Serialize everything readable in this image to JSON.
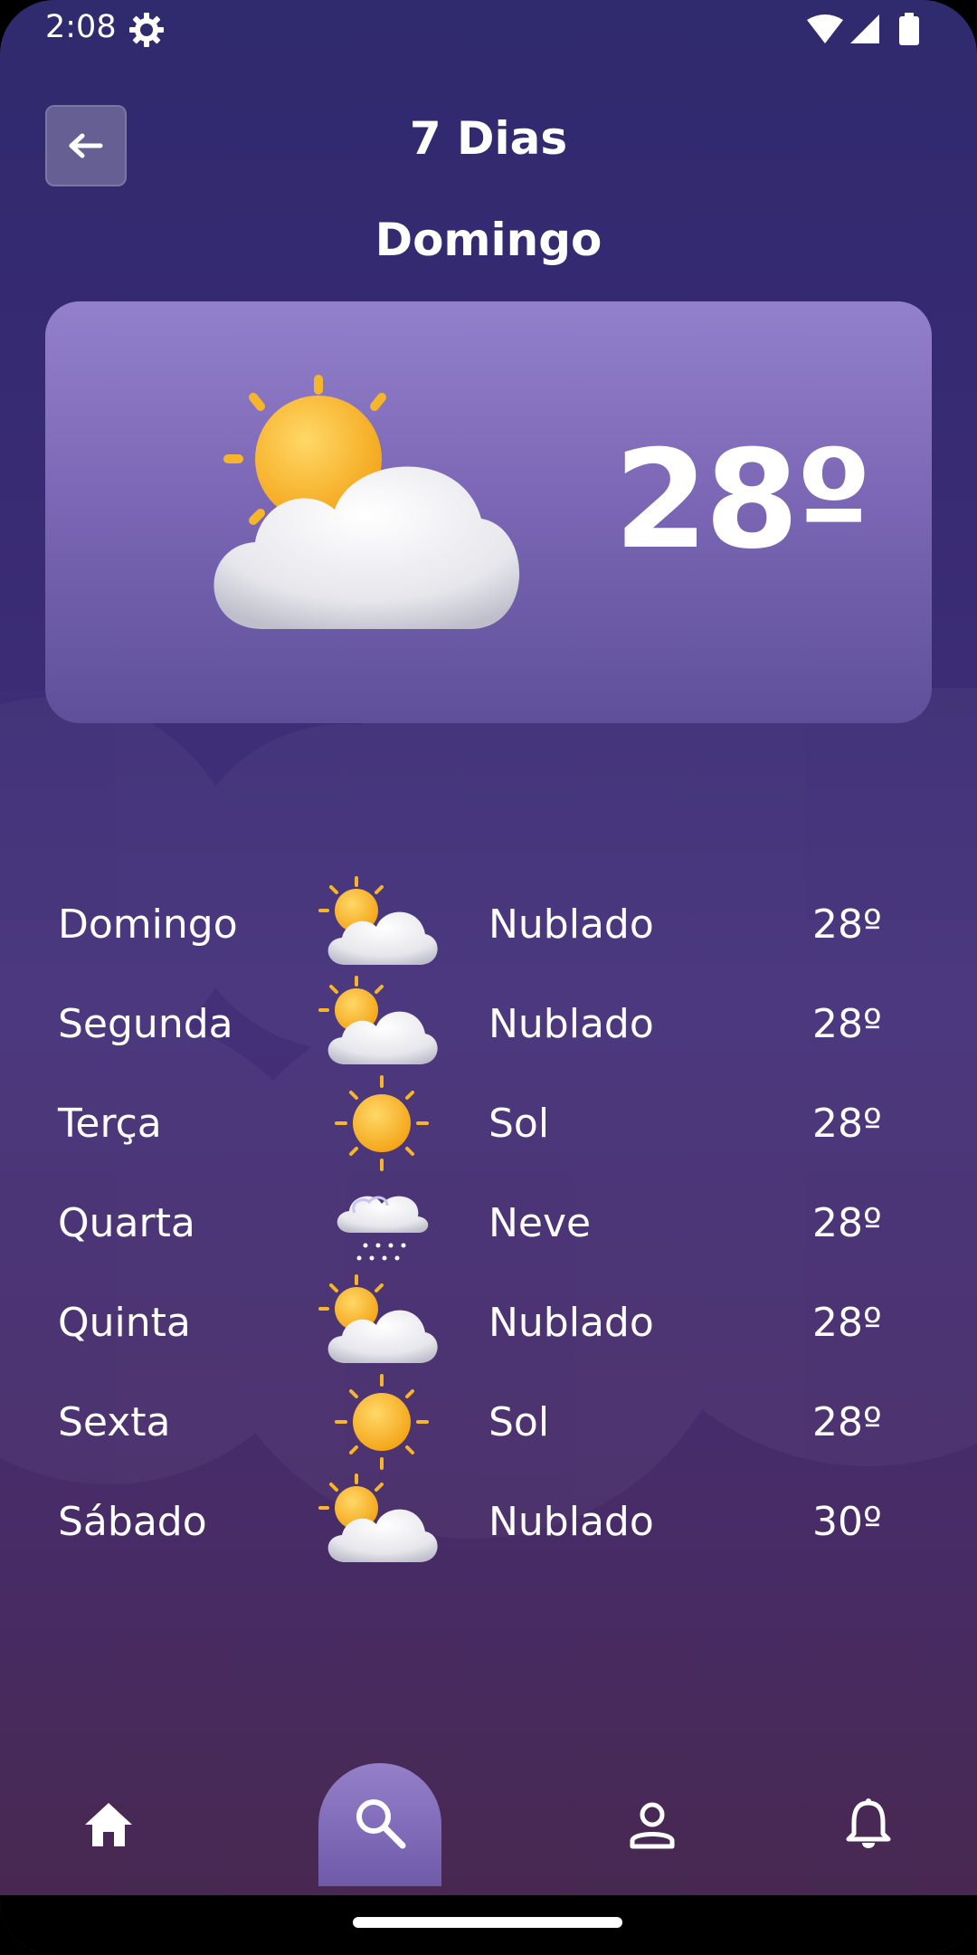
{
  "status_bar": {
    "time": "2:08"
  },
  "header": {
    "title": "7 Dias",
    "day": "Domingo"
  },
  "current": {
    "temp": "28º",
    "icon": "partly-cloudy-icon"
  },
  "forecast": [
    {
      "day": "Domingo",
      "condition": "Nublado",
      "temp": "28º",
      "icon": "partly-cloudy-icon"
    },
    {
      "day": "Segunda",
      "condition": "Nublado",
      "temp": "28º",
      "icon": "partly-cloudy-icon"
    },
    {
      "day": "Terça",
      "condition": "Sol",
      "temp": "28º",
      "icon": "sun-icon"
    },
    {
      "day": "Quarta",
      "condition": "Neve",
      "temp": "28º",
      "icon": "snow-icon"
    },
    {
      "day": "Quinta",
      "condition": "Nublado",
      "temp": "28º",
      "icon": "partly-cloudy-icon"
    },
    {
      "day": "Sexta",
      "condition": "Sol",
      "temp": "28º",
      "icon": "sun-icon"
    },
    {
      "day": "Sábado",
      "condition": "Nublado",
      "temp": "30º",
      "icon": "partly-cloudy-icon"
    }
  ],
  "nav": {
    "items": [
      "home-icon",
      "search-icon",
      "profile-icon",
      "bell-icon"
    ],
    "active": "search-icon"
  },
  "colors": {
    "sun": "#f9b825",
    "cloud": "#e9e9ee",
    "card_top": "#9380cb"
  }
}
